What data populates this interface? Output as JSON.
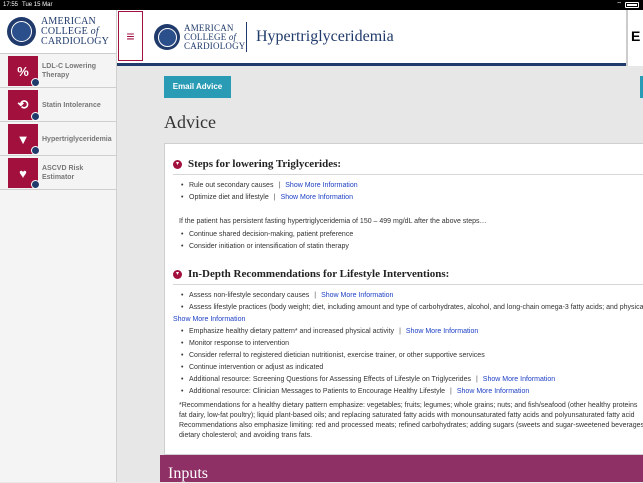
{
  "status_bar": {
    "time": "17:55",
    "date": "Tue 15 Mar"
  },
  "brand": {
    "line1": "AMERICAN",
    "line2": "COLLEGE",
    "of": "of",
    "line3": "CARDIOLOGY"
  },
  "sidebar": {
    "items": [
      {
        "label_line1": "LDL-C Lowering",
        "label_line2": "Therapy",
        "glyph": "%"
      },
      {
        "label_line1": "Statin Intolerance",
        "label_line2": "",
        "glyph": "⟲"
      },
      {
        "label_line1": "Hypertriglyceridemia",
        "label_line2": "",
        "glyph": "▼"
      },
      {
        "label_line1": "ASCVD Risk",
        "label_line2": "Estimator",
        "glyph": "♥"
      }
    ]
  },
  "header": {
    "title": "Hypertriglyceridemia",
    "menu_icon": "≡",
    "edge_letter": "E"
  },
  "email_button": "Email Advice",
  "advice_title": "Advice",
  "section1": {
    "title": "Steps for lowering Triglycerides:",
    "items": [
      {
        "text": "Rule out secondary causes",
        "more": "Show More Information"
      },
      {
        "text": "Optimize diet and lifestyle",
        "more": "Show More Information"
      }
    ],
    "paragraph": "If the patient has persistent fasting hypertriglyceridemia of 150 – 499 mg/dL after the above steps…",
    "items2": [
      {
        "text": "Continue shared decision-making, patient preference"
      },
      {
        "text": "Consider initiation or intensification of statin therapy"
      }
    ]
  },
  "section2": {
    "title": "In-Depth Recommendations for Lifestyle Interventions:",
    "items": [
      {
        "text": "Assess non-lifestyle secondary causes",
        "more": "Show More Information"
      },
      {
        "text": "Assess lifestyle practices (body weight; diet, including amount and type of carbohydrates, alcohol, and long-chain omega-3 fatty acids; and physica",
        "more": ""
      },
      {
        "text": "Show More Information",
        "more": "",
        "is_link_line": true
      },
      {
        "text": "Emphasize healthy dietary pattern* and increased physical activity",
        "more": "Show More Information"
      },
      {
        "text": "Monitor response to intervention",
        "more": ""
      },
      {
        "text": "Consider referral to registered dietician nutritionist, exercise trainer, or other supportive services",
        "more": ""
      },
      {
        "text": "Continue intervention or adjust as indicated",
        "more": ""
      },
      {
        "text": "Additional resource: Screening Questions for Assessing Effects of Lifestyle on Triglycerides",
        "more": "Show More Information"
      },
      {
        "text": "Additional resource: Clinician Messages to Patients to Encourage Healthy Lifestyle",
        "more": "Show More Information"
      }
    ],
    "footnote_l1": "*Recommendations for a healthy dietary pattern emphasize: vegetables; fruits; legumes; whole grains; nuts; and fish/seafood (other healthy proteins",
    "footnote_l2": "fat dairy, low-fat poultry); liquid plant-based oils; and replacing saturated fatty acids with monounsaturated fatty acids and polyunsaturated fatty acid",
    "footnote_l3": "Recommendations also emphasize limiting: red and processed meats; refined carbohydrates; adding sugars (sweets and sugar-sweetened beverages",
    "footnote_l4": "dietary cholesterol; and avoiding trans fats."
  },
  "inputs_title": "Inputs",
  "colors": {
    "brand_navy": "#1f3a6b",
    "accent_maroon": "#a2103e",
    "button_teal": "#2a9bb5",
    "link_blue": "#1c3fc4",
    "inputs_band": "#8e2f66"
  }
}
